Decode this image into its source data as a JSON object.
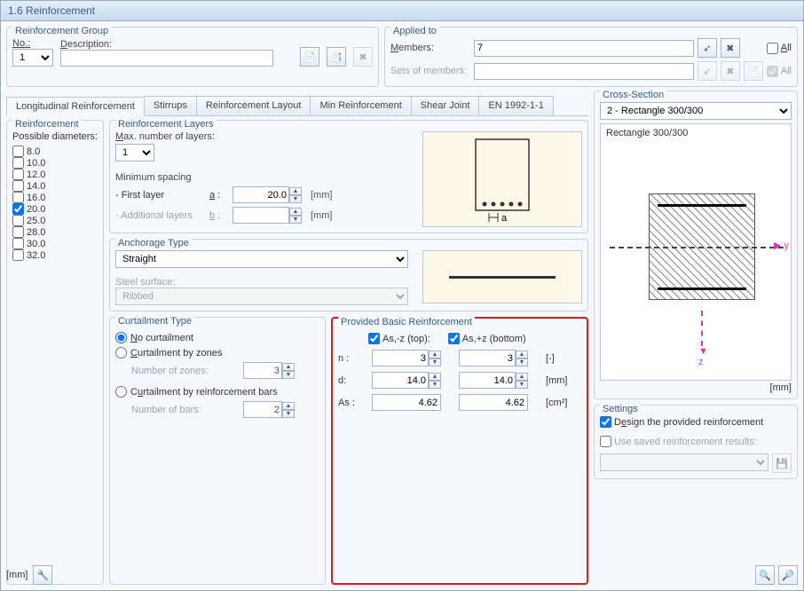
{
  "window": {
    "title": "1.6 Reinforcement"
  },
  "groups": {
    "reinforcement_group": "Reinforcement Group",
    "applied_to": "Applied to",
    "reinforcement": "Reinforcement",
    "possible_diameters": "Possible diameters:",
    "reinforcement_layers": "Reinforcement Layers",
    "anchorage_type": "Anchorage Type",
    "curtailment_type": "Curtailment Type",
    "provided_basic": "Provided Basic Reinforcement",
    "cross_section": "Cross-Section",
    "settings": "Settings"
  },
  "fields": {
    "no_label": "No.:",
    "no_value": "1",
    "description_label": "Description:",
    "description_value": "",
    "members_label": "Members:",
    "members_value": "7",
    "sets_label": "Sets of members:",
    "sets_value": "",
    "all_label": "All",
    "max_layers_label": "Max. number of layers:",
    "max_layers_value": "1",
    "min_spacing": "Minimum spacing",
    "first_layer_label": "- First layer",
    "first_layer_sym": "a :",
    "first_layer_value": "20.0",
    "additional_label": "- Additional layers",
    "additional_sym": "b :",
    "anchorage_value": "Straight",
    "steel_surface": "Steel surface:",
    "steel_surface_value": "Ribbed",
    "no_curtailment": "No curtailment",
    "curtail_zones": "Curtailment by zones",
    "number_zones": "Number of zones:",
    "number_zones_value": "3",
    "curtail_bars": "Curtailment by reinforcement bars",
    "number_bars": "Number of bars:",
    "number_bars_value": "2",
    "as_top": "As,-z (top):",
    "as_bottom": "As,+z (bottom)",
    "n_label": "n :",
    "n_top": "3",
    "n_bottom": "3",
    "n_unit": "[-]",
    "d_label": "d:",
    "d_top": "14.0",
    "d_bottom": "14.0",
    "d_unit": "[mm]",
    "as_label": "As :",
    "as_top_val": "4.62",
    "as_bottom_val": "4.62",
    "as_unit": "[cm²]",
    "cross_section_value": "2 - Rectangle 300/300",
    "cross_section_name": "Rectangle 300/300",
    "design_provided": "Design the provided reinforcement",
    "use_saved": "Use saved reinforcement results:"
  },
  "units": {
    "mm": "[mm]"
  },
  "tabs": [
    "Longitudinal Reinforcement",
    "Stirrups",
    "Reinforcement Layout",
    "Min Reinforcement",
    "Shear Joint",
    "EN 1992-1-1"
  ],
  "diameters": [
    {
      "v": "8.0",
      "c": false
    },
    {
      "v": "10.0",
      "c": false
    },
    {
      "v": "12.0",
      "c": false
    },
    {
      "v": "14.0",
      "c": false
    },
    {
      "v": "16.0",
      "c": false
    },
    {
      "v": "20.0",
      "c": true
    },
    {
      "v": "25.0",
      "c": false
    },
    {
      "v": "28.0",
      "c": false
    },
    {
      "v": "30.0",
      "c": false
    },
    {
      "v": "32.0",
      "c": false
    }
  ]
}
